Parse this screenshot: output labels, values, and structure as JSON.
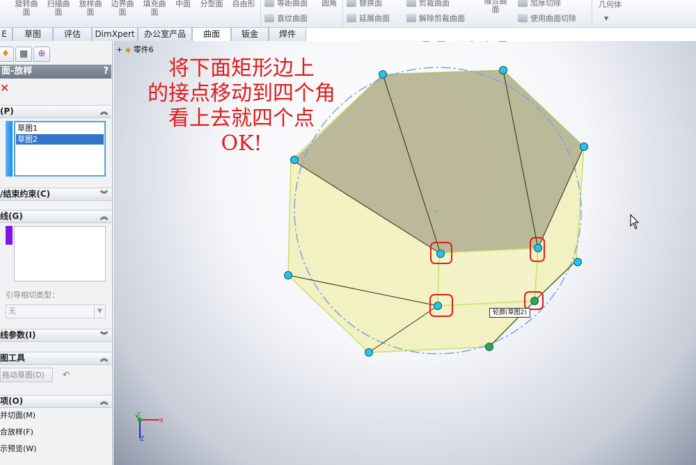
{
  "ribbon": {
    "big_buttons": [
      {
        "l1": "旋转曲",
        "l2": "面"
      },
      {
        "l1": "扫描曲",
        "l2": "面"
      },
      {
        "l1": "放样曲",
        "l2": "面"
      },
      {
        "l1": "边界曲",
        "l2": "面"
      },
      {
        "l1": "填充曲",
        "l2": "面"
      },
      {
        "l1": "中面",
        "l2": ""
      },
      {
        "l1": "分型面",
        "l2": ""
      },
      {
        "l1": "自由形",
        "l2": ""
      }
    ],
    "small_buttons": [
      "等距曲面",
      "直纹曲面",
      "圆角",
      "替换面",
      "延展曲面",
      "剪裁曲面",
      "解除剪裁曲面",
      "缝合曲",
      "面",
      "加厚切除",
      "使用曲面切除",
      "几何体"
    ]
  },
  "tabs": [
    "E",
    "草图",
    "评估",
    "DimXpert",
    "办公室产品",
    "曲面",
    "钣金",
    "焊件"
  ],
  "active_tab": "曲面",
  "panel": {
    "title": "面-放样",
    "help": "?",
    "sections": {
      "profiles": "(P)",
      "start_end": "/结束约束(C)",
      "guides": "线(G)",
      "center": "线参数(I)",
      "sketch_tools": "图工具",
      "options": "项(O)"
    },
    "profiles_list": [
      "草图1",
      "草图2"
    ],
    "tangent_label": "引导相切类型：",
    "tangent_value": "无",
    "drag_sketch": "拖动草图(D)",
    "options": [
      "并切面(M)",
      "合放样(F)",
      "示预览(W)"
    ]
  },
  "viewport": {
    "tree_root": "零件6",
    "annotation_lines": [
      "将下面矩形边上",
      "的接点移动到四个角",
      "看上去就四个点",
      "OK!"
    ],
    "tag_label": "轮廓(草图2)",
    "axes": {
      "x": "X",
      "y": "Y",
      "z": "Z"
    }
  },
  "colors": {
    "annotation": "#e01c1c",
    "surface_fill": "#f1f0b8",
    "dark_fill": "#8c8a78",
    "connector_blue": "#21c7e6",
    "connector_green": "#2fa84a"
  }
}
